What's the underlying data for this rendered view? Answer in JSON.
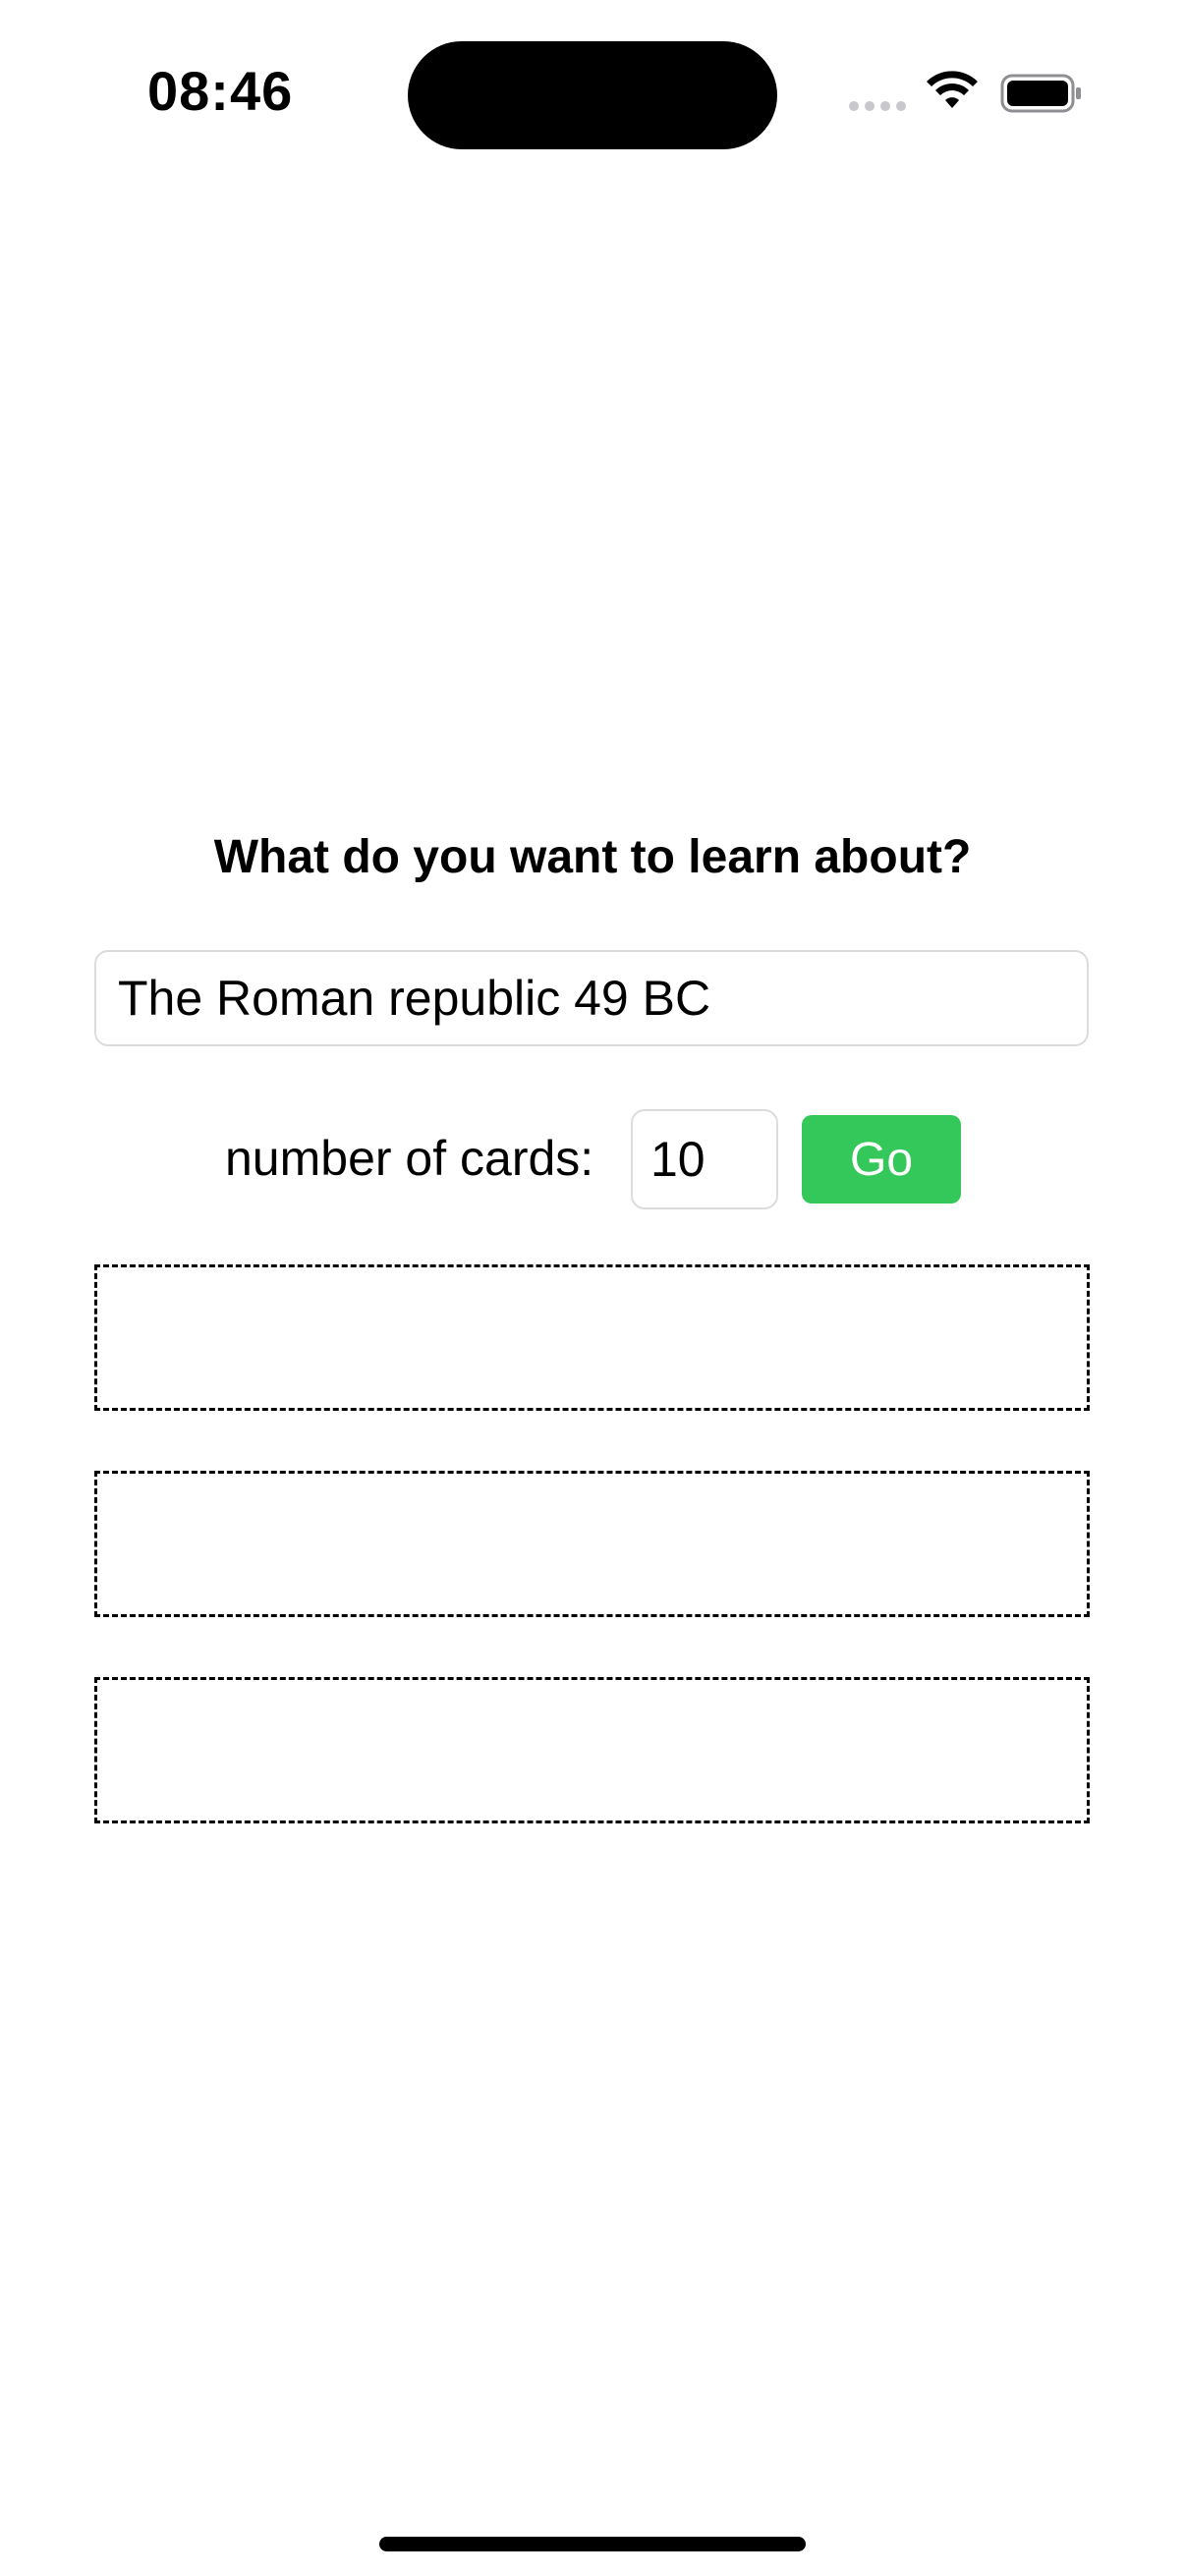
{
  "status_bar": {
    "time": "08:46",
    "icons": [
      "signal-dots-icon",
      "wifi-icon",
      "battery-icon"
    ]
  },
  "prompt": {
    "title": "What do you want to learn about?",
    "topic_value": "The Roman republic 49 BC"
  },
  "cards_control": {
    "label": "number of cards:",
    "count_value": "10",
    "go_label": "Go",
    "go_color": "#34c759"
  },
  "card_placeholders": [
    {
      "content": ""
    },
    {
      "content": ""
    },
    {
      "content": ""
    }
  ]
}
